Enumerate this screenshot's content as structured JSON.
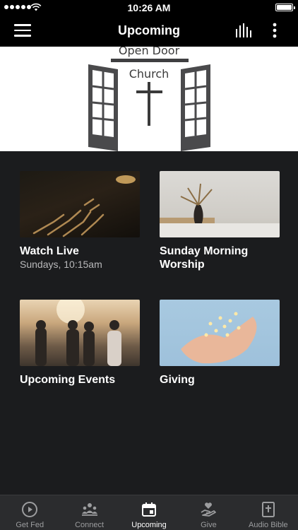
{
  "status_bar": {
    "time": "10:26 AM"
  },
  "navbar": {
    "title": "Upcoming"
  },
  "banner": {
    "line1": "Open Door",
    "line2": "Church"
  },
  "tiles": [
    {
      "label": "Watch Live",
      "sub": "Sundays, 10:15am",
      "image": "hands-raised-in-worship"
    },
    {
      "label": "Sunday Morning Worship",
      "sub": "",
      "image": "vase-with-dried-leaves"
    },
    {
      "label": "Upcoming Events",
      "sub": "",
      "image": "friends-at-sunset"
    },
    {
      "label": "Giving",
      "sub": "",
      "image": "hands-with-string-lights"
    }
  ],
  "tabbar": {
    "items": [
      {
        "label": "Get Fed",
        "icon": "play-circle-icon",
        "active": false
      },
      {
        "label": "Connect",
        "icon": "people-icon",
        "active": false
      },
      {
        "label": "Upcoming",
        "icon": "calendar-icon",
        "active": true
      },
      {
        "label": "Give",
        "icon": "heart-hand-icon",
        "active": false
      },
      {
        "label": "Audio Bible",
        "icon": "bible-icon",
        "active": false
      }
    ]
  },
  "colors": {
    "bar": "#000000",
    "background": "#1b1c1e",
    "tabbar": "#2b2c2e",
    "inactive_tab": "#9c9d9f"
  }
}
